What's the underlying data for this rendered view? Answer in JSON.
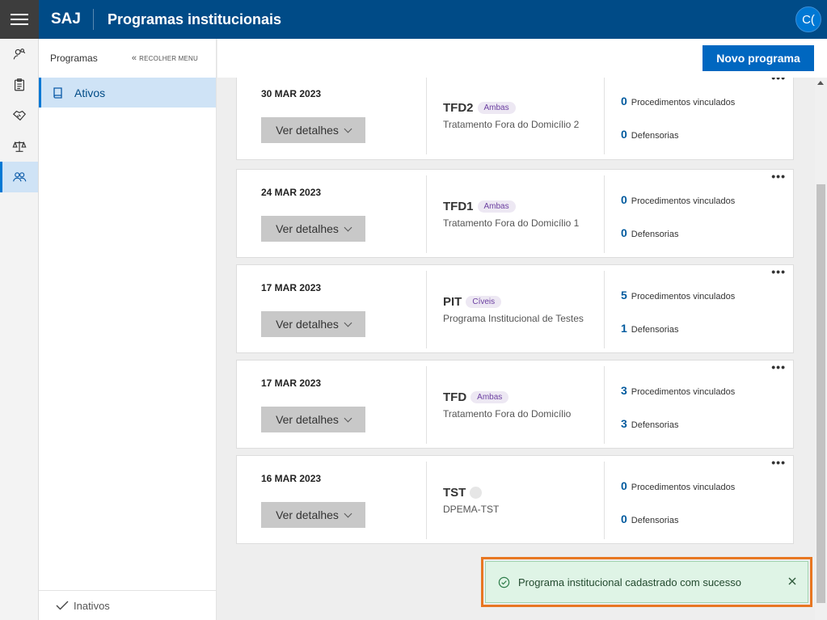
{
  "header": {
    "brand": "SAJ",
    "title": "Programas institucionais",
    "avatar_initials": "C("
  },
  "rail": {
    "items": [
      {
        "icon": "user-search-icon"
      },
      {
        "icon": "clipboard-icon"
      },
      {
        "icon": "handshake-icon"
      },
      {
        "icon": "scales-icon"
      },
      {
        "icon": "people-icon",
        "active": true
      }
    ]
  },
  "panel": {
    "title": "Programas",
    "collapse_label": "RECOLHER MENU",
    "active_item": "Ativos",
    "footer_item": "Inativos"
  },
  "toolbar": {
    "new_button": "Novo programa"
  },
  "cards": [
    {
      "date": "30 MAR 2023",
      "details_label": "Ver detalhes",
      "code": "TFD2",
      "tag": "Ambas",
      "description": "Tratamento Fora do Domicílio 2",
      "procedures_count": "0",
      "procedures_label": "Procedimentos vinculados",
      "offices_count": "0",
      "offices_label": "Defensorias",
      "more": "•••"
    },
    {
      "date": "24 MAR 2023",
      "details_label": "Ver detalhes",
      "code": "TFD1",
      "tag": "Ambas",
      "description": "Tratamento Fora do Domicílio 1",
      "procedures_count": "0",
      "procedures_label": "Procedimentos vinculados",
      "offices_count": "0",
      "offices_label": "Defensorias",
      "more": "•••"
    },
    {
      "date": "17 MAR 2023",
      "details_label": "Ver detalhes",
      "code": "PIT",
      "tag": "Cíveis",
      "description": "Programa Institucional de Testes",
      "procedures_count": "5",
      "procedures_label": "Procedimentos vinculados",
      "offices_count": "1",
      "offices_label": "Defensorias",
      "more": "•••"
    },
    {
      "date": "17 MAR 2023",
      "details_label": "Ver detalhes",
      "code": "TFD",
      "tag": "Ambas",
      "description": "Tratamento Fora do Domicílio",
      "procedures_count": "3",
      "procedures_label": "Procedimentos vinculados",
      "offices_count": "3",
      "offices_label": "Defensorias",
      "more": "•••"
    },
    {
      "date": "16 MAR 2023",
      "details_label": "Ver detalhes",
      "code": "TST",
      "tag": "",
      "description": "DPEMA-TST",
      "procedures_count": "0",
      "procedures_label": "Procedimentos vinculados",
      "offices_count": "0",
      "offices_label": "Defensorias",
      "more": "•••"
    }
  ],
  "toast": {
    "message": "Programa institucional cadastrado com sucesso",
    "status_color": "#dff4e6",
    "highlight_color": "#e87722"
  }
}
